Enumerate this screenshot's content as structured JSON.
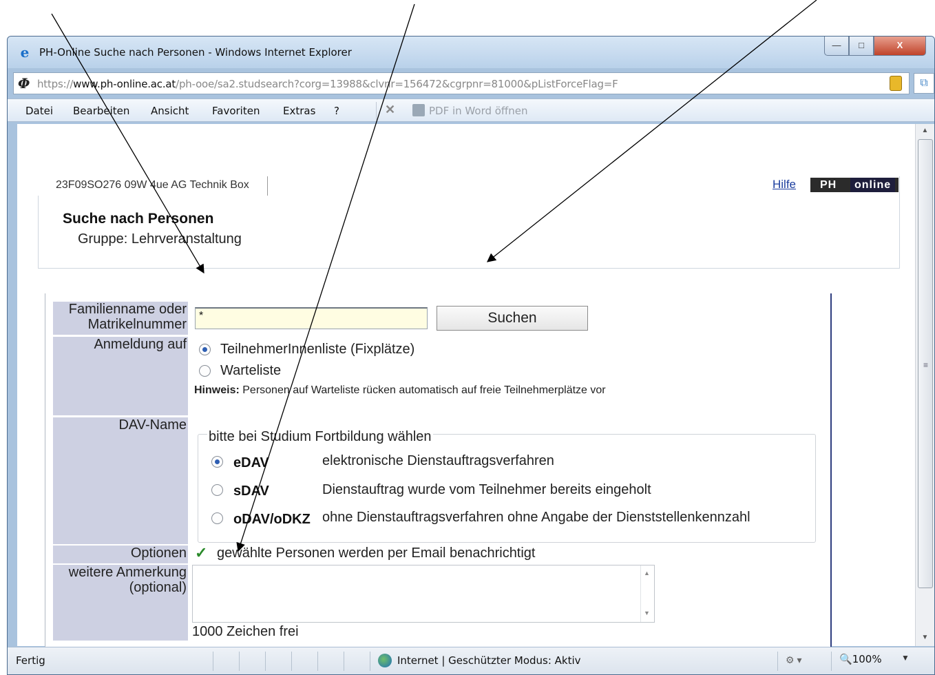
{
  "window": {
    "title": "PH-Online Suche nach Personen - Windows Internet Explorer",
    "minimize": "—",
    "maximize": "□",
    "close": "X"
  },
  "address": {
    "prefix": "https://",
    "domain": "www.ph-online.ac.at",
    "path": "/ph-ooe/sa2.studsearch?corg=13988&clvnr=156472&cgrpnr=81000&pListForceFlag=F"
  },
  "menu": {
    "items": [
      "Datei",
      "Bearbeiten",
      "Ansicht",
      "Favoriten",
      "Extras",
      "?"
    ],
    "pdf_label": "PDF in Word öffnen"
  },
  "page": {
    "tab_label": "23F09SO276 09W 4ue AG Technik Box",
    "help_link": "Hilfe",
    "logo_ph": "PH",
    "logo_online": "online",
    "title": "Suche nach Personen",
    "subtitle": "Gruppe: Lehrveranstaltung"
  },
  "form": {
    "name_label": "Familienname oder Matrikelnummer",
    "name_value": "*",
    "search_button": "Suchen",
    "anmeldung_label": "Anmeldung auf",
    "anmeldung_options": [
      {
        "label": "TeilnehmerInnenliste (Fixplätze)",
        "selected": true
      },
      {
        "label": "Warteliste",
        "selected": false
      }
    ],
    "hint_bold": "Hinweis:",
    "hint_text": "Personen auf Warteliste rücken automatisch auf freie Teilnehmerplätze vor",
    "dav_label": "DAV-Name",
    "dav_legend": "bitte bei Studium Fortbildung wählen",
    "dav_options": [
      {
        "code": "eDAV",
        "desc": "elektronische Dienstauftragsverfahren",
        "selected": true
      },
      {
        "code": "sDAV",
        "desc": "Dienstauftrag wurde vom Teilnehmer bereits eingeholt",
        "selected": false
      },
      {
        "code": "oDAV/oDKZ",
        "desc": "ohne Dienstauftragsverfahren ohne Angabe der Dienststellenkennzahl",
        "selected": false
      }
    ],
    "options_label": "Optionen",
    "options_text": "gewählte Personen werden per Email benachrichtigt",
    "remark_label": "weitere Anmerkung (optional)",
    "remark_value": "",
    "chars_free": "1000 Zeichen frei"
  },
  "status": {
    "text": "Fertig",
    "zone": "Internet | Geschützter Modus: Aktiv",
    "zoom": "100%"
  },
  "colors": {
    "label_bg": "#cdd0e2",
    "input_bg": "#fffde2",
    "panel_border": "#2d3c7e",
    "link": "#1a3c9e"
  }
}
